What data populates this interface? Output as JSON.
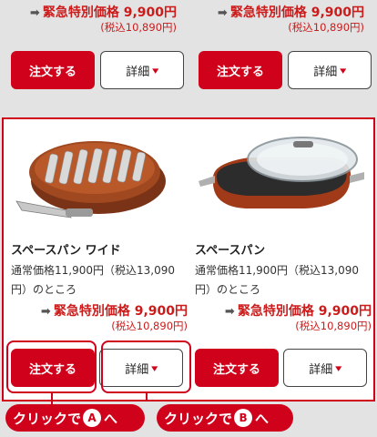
{
  "top_cards": [
    {
      "price_label": "緊急特別価格 9,900円",
      "price_tax": "(税込10,890円)",
      "order_label": "注文する",
      "detail_label": "詳細"
    },
    {
      "price_label": "緊急特別価格 9,900円",
      "price_tax": "(税込10,890円)",
      "order_label": "注文する",
      "detail_label": "詳細"
    }
  ],
  "products": [
    {
      "name": "スペースパン ワイド",
      "regular_price": "通常価格11,900円（税込13,090円）のところ",
      "price_label": "緊急特別価格 9,900円",
      "price_tax": "(税込10,890円)",
      "order_label": "注文する",
      "detail_label": "詳細"
    },
    {
      "name": "スペースパン",
      "regular_price": "通常価格11,900円（税込13,090円）のところ",
      "price_label": "緊急特別価格 9,900円",
      "price_tax": "(税込10,890円)",
      "order_label": "注文する",
      "detail_label": "詳細"
    }
  ],
  "callouts": [
    {
      "prefix": "クリックで",
      "letter": "A",
      "suffix": "へ"
    },
    {
      "prefix": "クリックで",
      "letter": "B",
      "suffix": "へ"
    }
  ],
  "icons": {
    "arrow": "arrow-right-icon",
    "chevron": "chevron-down-icon"
  },
  "colors": {
    "accent": "#d0021b",
    "background": "#e3e3e3"
  }
}
